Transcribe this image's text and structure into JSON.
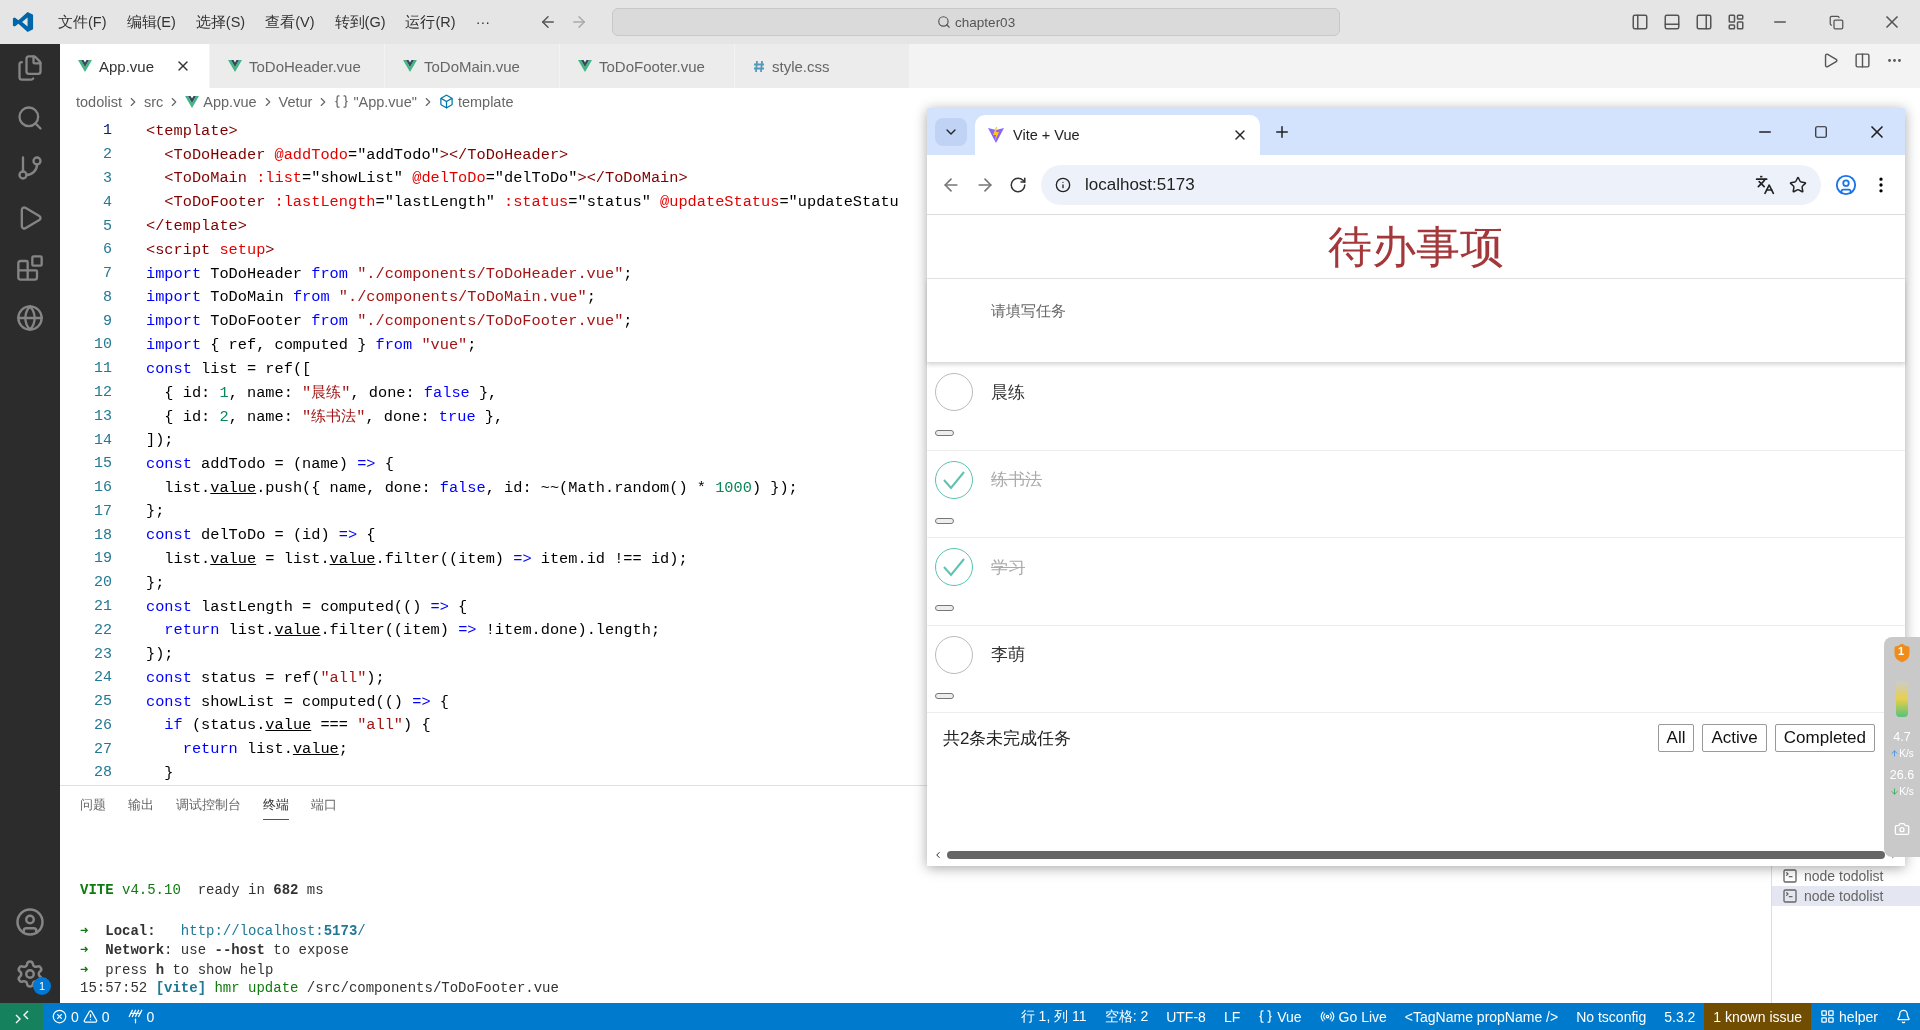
{
  "menu": [
    "文件(F)",
    "编辑(E)",
    "选择(S)",
    "查看(V)",
    "转到(G)",
    "运行(R)",
    "···"
  ],
  "command_center": {
    "text": "chapter03"
  },
  "activity_bar": {
    "settings_badge": "1"
  },
  "editor_tabs": [
    {
      "label": "App.vue",
      "kind": "vue",
      "selected": true
    },
    {
      "label": "ToDoHeader.vue",
      "kind": "vue",
      "selected": false
    },
    {
      "label": "ToDoMain.vue",
      "kind": "vue",
      "selected": false
    },
    {
      "label": "ToDoFooter.vue",
      "kind": "vue",
      "selected": false
    },
    {
      "label": "style.css",
      "kind": "css",
      "selected": false
    }
  ],
  "breadcrumb": [
    {
      "label": "todolist",
      "kind": "text"
    },
    {
      "label": "src",
      "kind": "text"
    },
    {
      "label": "App.vue",
      "kind": "vue"
    },
    {
      "label": "Vetur",
      "kind": "text"
    },
    {
      "label": "\"App.vue\"",
      "kind": "object"
    },
    {
      "label": "template",
      "kind": "element"
    }
  ],
  "code_lines": [
    {
      "number": "1",
      "tokens": [
        {
          "kind": "tag",
          "text": "<template>"
        }
      ]
    },
    {
      "number": "2",
      "tokens": [
        {
          "kind": "tag",
          "text": "  <ToDoHeader "
        },
        {
          "kind": "attr",
          "text": "@addTodo"
        },
        {
          "kind": "plain",
          "text": "=\"addTodo\""
        },
        {
          "kind": "tag",
          "text": "></ToDoHeader>"
        }
      ]
    },
    {
      "number": "3",
      "tokens": [
        {
          "kind": "tag",
          "text": "  <ToDoMain "
        },
        {
          "kind": "attr",
          "text": ":list"
        },
        {
          "kind": "plain",
          "text": "=\"showList\" "
        },
        {
          "kind": "attr",
          "text": "@delToDo"
        },
        {
          "kind": "plain",
          "text": "=\"delToDo\""
        },
        {
          "kind": "tag",
          "text": "></ToDoMain>"
        }
      ]
    },
    {
      "number": "4",
      "tokens": [
        {
          "kind": "tag",
          "text": "  <ToDoFooter "
        },
        {
          "kind": "attr",
          "text": ":lastLength"
        },
        {
          "kind": "plain",
          "text": "=\"lastLength\" "
        },
        {
          "kind": "attr",
          "text": ":status"
        },
        {
          "kind": "plain",
          "text": "=\"status\" "
        },
        {
          "kind": "attr",
          "text": "@updateStatus"
        },
        {
          "kind": "plain",
          "text": "=\"updateStatu"
        }
      ]
    },
    {
      "number": "5",
      "tokens": [
        {
          "kind": "tag",
          "text": "</template>"
        }
      ]
    },
    {
      "number": "6",
      "tokens": [
        {
          "kind": "tag",
          "text": "<script "
        },
        {
          "kind": "attr",
          "text": "setup"
        },
        {
          "kind": "tag",
          "text": ">"
        }
      ]
    },
    {
      "number": "7",
      "tokens": [
        {
          "kind": "keyword",
          "text": "import"
        },
        {
          "kind": "plain",
          "text": " ToDoHeader "
        },
        {
          "kind": "keyword",
          "text": "from"
        },
        {
          "kind": "string",
          "text": " \"./components/ToDoHeader.vue\""
        },
        {
          "kind": "plain",
          "text": ";"
        }
      ]
    },
    {
      "number": "8",
      "tokens": [
        {
          "kind": "keyword",
          "text": "import"
        },
        {
          "kind": "plain",
          "text": " ToDoMain "
        },
        {
          "kind": "keyword",
          "text": "from"
        },
        {
          "kind": "string",
          "text": " \"./components/ToDoMain.vue\""
        },
        {
          "kind": "plain",
          "text": ";"
        }
      ]
    },
    {
      "number": "9",
      "tokens": [
        {
          "kind": "keyword",
          "text": "import"
        },
        {
          "kind": "plain",
          "text": " ToDoFooter "
        },
        {
          "kind": "keyword",
          "text": "from"
        },
        {
          "kind": "string",
          "text": " \"./components/ToDoFooter.vue\""
        },
        {
          "kind": "plain",
          "text": ";"
        }
      ]
    },
    {
      "number": "10",
      "tokens": [
        {
          "kind": "keyword",
          "text": "import"
        },
        {
          "kind": "plain",
          "text": " { ref, computed } "
        },
        {
          "kind": "keyword",
          "text": "from"
        },
        {
          "kind": "string",
          "text": " \"vue\""
        },
        {
          "kind": "plain",
          "text": ";"
        }
      ]
    },
    {
      "number": "11",
      "tokens": [
        {
          "kind": "keyword",
          "text": "const"
        },
        {
          "kind": "plain",
          "text": " list = ref(["
        }
      ]
    },
    {
      "number": "12",
      "tokens": [
        {
          "kind": "plain",
          "text": "  { id: "
        },
        {
          "kind": "number",
          "text": "1"
        },
        {
          "kind": "plain",
          "text": ", name: "
        },
        {
          "kind": "string",
          "text": "\"晨练\""
        },
        {
          "kind": "plain",
          "text": ", done: "
        },
        {
          "kind": "keyword",
          "text": "false"
        },
        {
          "kind": "plain",
          "text": " },"
        }
      ]
    },
    {
      "number": "13",
      "tokens": [
        {
          "kind": "plain",
          "text": "  { id: "
        },
        {
          "kind": "number",
          "text": "2"
        },
        {
          "kind": "plain",
          "text": ", name: "
        },
        {
          "kind": "string",
          "text": "\"练书法\""
        },
        {
          "kind": "plain",
          "text": ", done: "
        },
        {
          "kind": "keyword",
          "text": "true"
        },
        {
          "kind": "plain",
          "text": " },"
        }
      ]
    },
    {
      "number": "14",
      "tokens": [
        {
          "kind": "plain",
          "text": "]);"
        }
      ]
    },
    {
      "number": "15",
      "tokens": [
        {
          "kind": "keyword",
          "text": "const"
        },
        {
          "kind": "plain",
          "text": " addTodo = (name) "
        },
        {
          "kind": "keyword",
          "text": "=>"
        },
        {
          "kind": "plain",
          "text": " {"
        }
      ]
    },
    {
      "number": "16",
      "tokens": [
        {
          "kind": "plain",
          "text": "  list."
        },
        {
          "kind": "value",
          "text": "value"
        },
        {
          "kind": "plain",
          "text": ".push({ name, done: "
        },
        {
          "kind": "keyword",
          "text": "false"
        },
        {
          "kind": "plain",
          "text": ", id: ~~(Math.random() * "
        },
        {
          "kind": "number",
          "text": "1000"
        },
        {
          "kind": "plain",
          "text": ") });"
        }
      ]
    },
    {
      "number": "17",
      "tokens": [
        {
          "kind": "plain",
          "text": "};"
        }
      ]
    },
    {
      "number": "18",
      "tokens": [
        {
          "kind": "keyword",
          "text": "const"
        },
        {
          "kind": "plain",
          "text": " delToDo = (id) "
        },
        {
          "kind": "keyword",
          "text": "=>"
        },
        {
          "kind": "plain",
          "text": " {"
        }
      ]
    },
    {
      "number": "19",
      "tokens": [
        {
          "kind": "plain",
          "text": "  list."
        },
        {
          "kind": "value",
          "text": "value"
        },
        {
          "kind": "plain",
          "text": " = list."
        },
        {
          "kind": "value",
          "text": "value"
        },
        {
          "kind": "plain",
          "text": ".filter((item) "
        },
        {
          "kind": "keyword",
          "text": "=>"
        },
        {
          "kind": "plain",
          "text": " item.id !== id);"
        }
      ]
    },
    {
      "number": "20",
      "tokens": [
        {
          "kind": "plain",
          "text": "};"
        }
      ]
    },
    {
      "number": "21",
      "tokens": [
        {
          "kind": "keyword",
          "text": "const"
        },
        {
          "kind": "plain",
          "text": " lastLength = computed(() "
        },
        {
          "kind": "keyword",
          "text": "=>"
        },
        {
          "kind": "plain",
          "text": " {"
        }
      ]
    },
    {
      "number": "22",
      "tokens": [
        {
          "kind": "keyword",
          "text": "  return"
        },
        {
          "kind": "plain",
          "text": " list."
        },
        {
          "kind": "value",
          "text": "value"
        },
        {
          "kind": "plain",
          "text": ".filter((item) "
        },
        {
          "kind": "keyword",
          "text": "=>"
        },
        {
          "kind": "plain",
          "text": " !item.done).length;"
        }
      ]
    },
    {
      "number": "23",
      "tokens": [
        {
          "kind": "plain",
          "text": "});"
        }
      ]
    },
    {
      "number": "24",
      "tokens": [
        {
          "kind": "keyword",
          "text": "const"
        },
        {
          "kind": "plain",
          "text": " status = ref("
        },
        {
          "kind": "string",
          "text": "\"all\""
        },
        {
          "kind": "plain",
          "text": ");"
        }
      ]
    },
    {
      "number": "25",
      "tokens": [
        {
          "kind": "keyword",
          "text": "const"
        },
        {
          "kind": "plain",
          "text": " showList = computed(() "
        },
        {
          "kind": "keyword",
          "text": "=>"
        },
        {
          "kind": "plain",
          "text": " {"
        }
      ]
    },
    {
      "number": "26",
      "tokens": [
        {
          "kind": "keyword",
          "text": "  if"
        },
        {
          "kind": "plain",
          "text": " (status."
        },
        {
          "kind": "value",
          "text": "value"
        },
        {
          "kind": "plain",
          "text": " === "
        },
        {
          "kind": "string",
          "text": "\"all\""
        },
        {
          "kind": "plain",
          "text": ") {"
        }
      ]
    },
    {
      "number": "27",
      "tokens": [
        {
          "kind": "keyword",
          "text": "    return"
        },
        {
          "kind": "plain",
          "text": " list."
        },
        {
          "kind": "value",
          "text": "value"
        },
        {
          "kind": "plain",
          "text": ";"
        }
      ]
    },
    {
      "number": "28",
      "tokens": [
        {
          "kind": "plain",
          "text": "  }"
        }
      ]
    }
  ],
  "panel": {
    "tabs": [
      {
        "label": "问题",
        "selected": false
      },
      {
        "label": "输出",
        "selected": false
      },
      {
        "label": "调试控制台",
        "selected": false
      },
      {
        "label": "终端",
        "selected": true
      },
      {
        "label": "端口",
        "selected": false
      }
    ],
    "terminal_blocks": [
      {
        "lines": [
          {
            "tokens": [
              {
                "kind": "green-bold",
                "text": "VITE"
              },
              {
                "kind": "green",
                "text": " v4.5.10"
              },
              {
                "kind": "plain",
                "text": "  ready in "
              },
              {
                "kind": "bold",
                "text": "682"
              },
              {
                "kind": "plain",
                "text": " ms"
              }
            ]
          }
        ]
      },
      {
        "lines": [
          {
            "tokens": [
              {
                "kind": "green",
                "text": "➜ "
              },
              {
                "kind": "bold",
                "text": " Local:"
              },
              {
                "kind": "cyan",
                "text": "   http://localhost:"
              },
              {
                "kind": "cyan-bold",
                "text": "5173"
              },
              {
                "kind": "cyan",
                "text": "/"
              }
            ]
          },
          {
            "tokens": [
              {
                "kind": "green",
                "text": "➜ "
              },
              {
                "kind": "bold",
                "text": " Network"
              },
              {
                "kind": "plain",
                "text": ": use "
              },
              {
                "kind": "bold",
                "text": "--host"
              },
              {
                "kind": "plain",
                "text": " to expose"
              }
            ]
          },
          {
            "tokens": [
              {
                "kind": "green",
                "text": "➜ "
              },
              {
                "kind": "plain",
                "text": " press "
              },
              {
                "kind": "bold",
                "text": "h"
              },
              {
                "kind": "plain",
                "text": " to show help"
              }
            ]
          },
          {
            "tokens": [
              {
                "kind": "plain",
                "text": "15:57:52 "
              },
              {
                "kind": "cyan-bold",
                "text": "[vite]"
              },
              {
                "kind": "green",
                "text": " hmr update"
              },
              {
                "kind": "plain",
                "text": " /src/components/ToDoFooter.vue"
              }
            ]
          }
        ]
      }
    ],
    "terminals": [
      {
        "label": "node  todolist",
        "selected": false
      },
      {
        "label": "node  todolist",
        "selected": true
      }
    ]
  },
  "status_bar": {
    "errors": "0",
    "warnings": "0",
    "ports": "0",
    "items": [
      {
        "label": "行 1, 列 11",
        "kind": "plain"
      },
      {
        "label": "空格: 2",
        "kind": "plain"
      },
      {
        "label": "UTF-8",
        "kind": "plain"
      },
      {
        "label": "LF",
        "kind": "plain"
      },
      {
        "label": "Vue",
        "kind": "language"
      },
      {
        "label": "Go Live",
        "kind": "live"
      },
      {
        "label": "<TagName propName />",
        "kind": "plain"
      },
      {
        "label": "No tsconfig",
        "kind": "plain"
      },
      {
        "label": "5.3.2",
        "kind": "plain"
      },
      {
        "label": "1 known issue",
        "kind": "warning"
      },
      {
        "label": "helper",
        "kind": "helper"
      },
      {
        "kind": "bell"
      }
    ]
  },
  "browser": {
    "tab_title": "Vite + Vue",
    "address": "localhost:5173",
    "page": {
      "title": "待办事项",
      "placeholder": "请填写任务",
      "todos": [
        {
          "name": "晨练",
          "done": false
        },
        {
          "name": "练书法",
          "done": true
        },
        {
          "name": "学习",
          "done": true
        },
        {
          "name": "李萌",
          "done": false
        }
      ],
      "footer_text": "共2条未完成任务",
      "filters": [
        "All",
        "Active",
        "Completed"
      ]
    }
  },
  "net_widget": {
    "badge": "1",
    "up": "4.7",
    "up_unit": "K/s",
    "down": "26.6",
    "down_unit": "K/s"
  }
}
